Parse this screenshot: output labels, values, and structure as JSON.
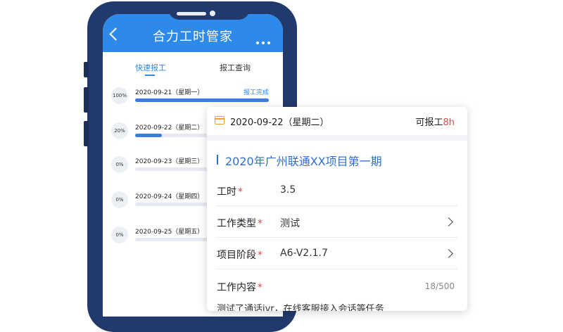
{
  "app": {
    "title": "合力工时管家"
  },
  "tabs": [
    {
      "label": "快速报工",
      "active": true
    },
    {
      "label": "报工查询",
      "active": false
    }
  ],
  "days": [
    {
      "percent": "100%",
      "progress": 1.0,
      "date": "2020-09-21（星期一）",
      "status": "报工完成"
    },
    {
      "percent": "20%",
      "progress": 0.2,
      "date": "2020-09-22（星期二）",
      "status": ""
    },
    {
      "percent": "0%",
      "progress": 0.0,
      "date": "2020-09-23（星期三）",
      "status": ""
    },
    {
      "percent": "0%",
      "progress": 0.0,
      "date": "2020-09-24（星期四）",
      "status": ""
    },
    {
      "percent": "0%",
      "progress": 0.0,
      "date": "2020-09-25（星期五）",
      "status": ""
    }
  ],
  "card": {
    "date": "2020-09-22（星期二）",
    "available_label": "可报工",
    "available_value": "8h",
    "project": "2020年广州联通XX项目第一期",
    "fields": {
      "hours": {
        "label": "工时",
        "required": "*",
        "value": "3.5"
      },
      "work_type": {
        "label": "工作类型",
        "required": "*",
        "value": "测试"
      },
      "stage": {
        "label": "项目阶段",
        "required": "*",
        "value": "A6-V2.1.7"
      },
      "content": {
        "label": "工作内容",
        "required": "*",
        "count": "18/500",
        "value": "测试了通话ivr，在线客服接入会话等任务"
      }
    }
  },
  "colors": {
    "brand": "#2d8ae8",
    "phone_frame": "#223a6b",
    "required": "#e04a43",
    "calendar_icon": "#e9a23b"
  }
}
